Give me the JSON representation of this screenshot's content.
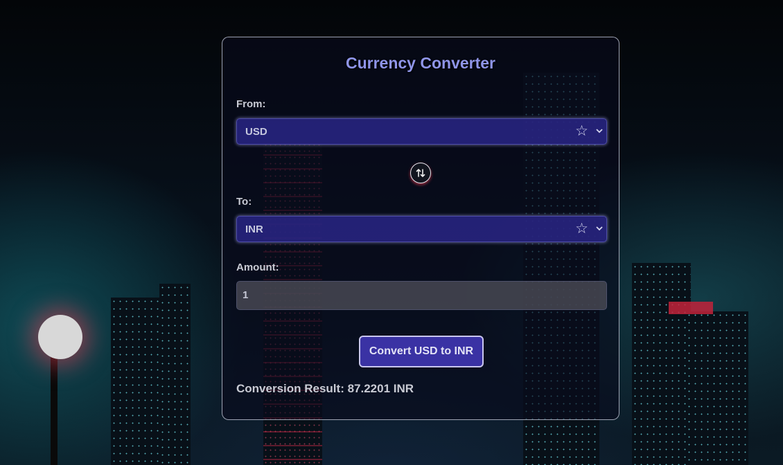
{
  "app": {
    "title": "Currency Converter"
  },
  "from": {
    "label": "From:",
    "selected": "USD",
    "favorite_icon": "star-outline-icon",
    "dropdown_icon": "chevron-down-icon"
  },
  "swap": {
    "icon": "swap-vertical-icon"
  },
  "to": {
    "label": "To:",
    "selected": "INR",
    "favorite_icon": "star-outline-icon",
    "dropdown_icon": "chevron-down-icon"
  },
  "amount": {
    "label": "Amount:",
    "value": "1"
  },
  "convert_button": {
    "label": "Convert USD to INR"
  },
  "result": {
    "text": "Conversion Result: 87.2201 INR"
  },
  "colors": {
    "accent": "#3a32a4",
    "title": "#8f95e8",
    "select_bg": "#28248a"
  }
}
